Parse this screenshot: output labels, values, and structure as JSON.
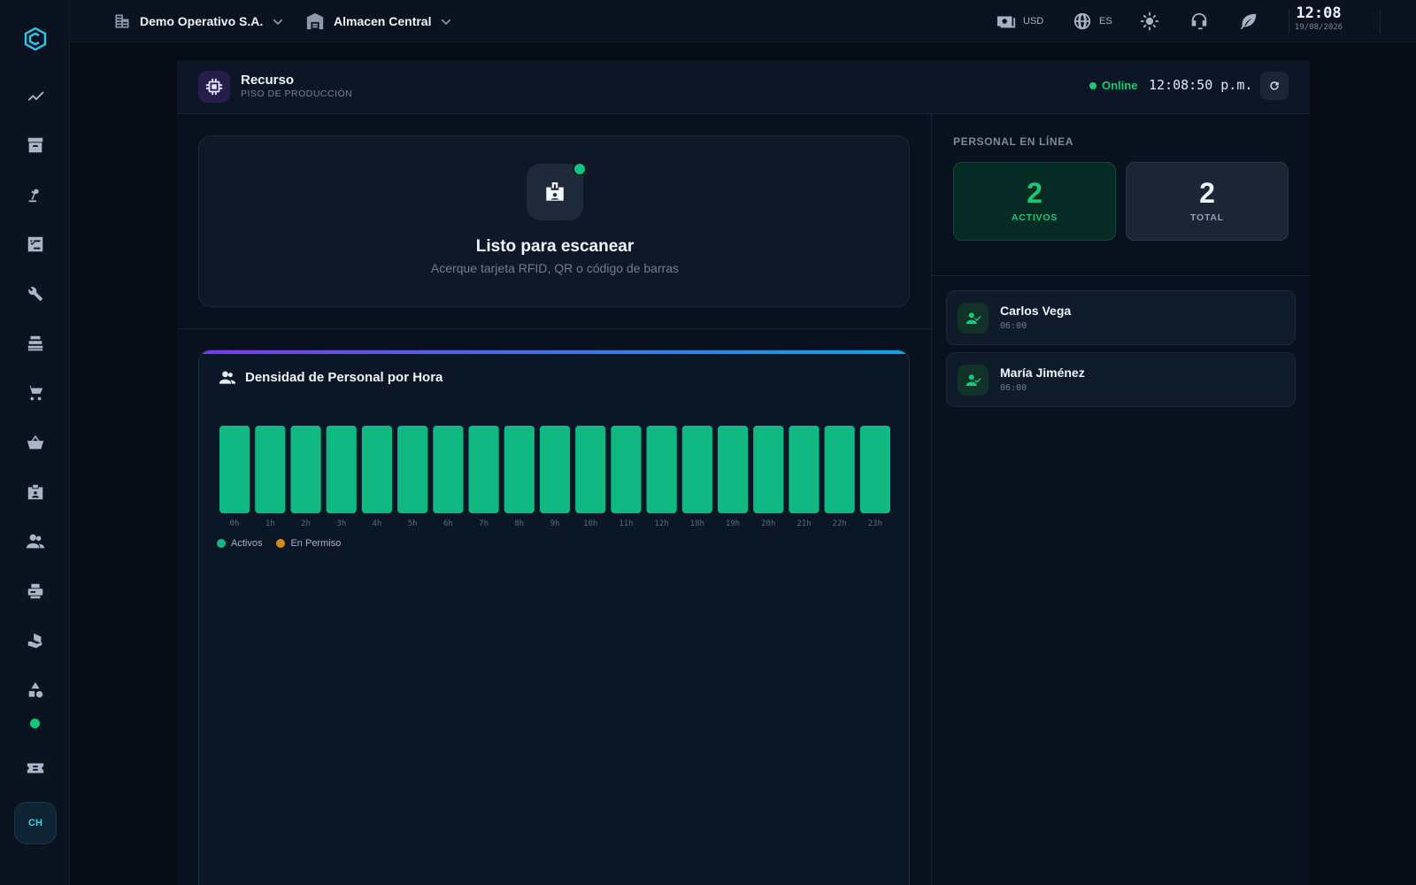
{
  "sidebar": {
    "logo": "brand-logo",
    "items": [
      {
        "icon": "trend-icon"
      },
      {
        "icon": "archive-icon"
      },
      {
        "icon": "robot-arm-icon"
      },
      {
        "icon": "checklist-icon"
      },
      {
        "icon": "wrench-icon"
      },
      {
        "icon": "server-icon"
      },
      {
        "icon": "cart-icon"
      },
      {
        "icon": "basket-icon"
      },
      {
        "icon": "badge-icon"
      },
      {
        "icon": "people-icon"
      },
      {
        "icon": "printer-icon"
      },
      {
        "icon": "package-hand-icon"
      },
      {
        "icon": "shapes-icon"
      },
      {
        "icon": "ticket-icon"
      }
    ],
    "avatar": "CH"
  },
  "topbar": {
    "company": "Demo Operativo S.A.",
    "warehouse": "Almacen Central",
    "currency": "USD",
    "language": "ES",
    "time": "12:08",
    "date": "19/08/2026"
  },
  "panel": {
    "title": "Recurso",
    "subtitle": "PISO DE PRODUCCIÓN",
    "status": "Online",
    "clock": "12:08:50 p.m."
  },
  "scan": {
    "title": "Listo para escanear",
    "subtitle": "Acerque tarjeta RFID, QR o código de barras"
  },
  "chart": {
    "title": "Densidad de Personal por Hora",
    "legend": [
      {
        "label": "Activos",
        "color": "#10b981"
      },
      {
        "label": "En Permiso",
        "color": "#d48a1a"
      }
    ]
  },
  "chart_data": {
    "type": "bar",
    "title": "Densidad de Personal por Hora",
    "categories": [
      "0h",
      "1h",
      "2h",
      "3h",
      "4h",
      "5h",
      "6h",
      "7h",
      "8h",
      "9h",
      "10h",
      "11h",
      "12h",
      "18h",
      "19h",
      "20h",
      "21h",
      "22h",
      "23h"
    ],
    "series": [
      {
        "name": "Activos",
        "values": [
          2,
          2,
          2,
          2,
          2,
          2,
          2,
          2,
          2,
          2,
          2,
          2,
          2,
          2,
          2,
          2,
          2,
          2,
          2
        ]
      },
      {
        "name": "En Permiso",
        "values": [
          0,
          0,
          0,
          0,
          0,
          0,
          0,
          0,
          0,
          0,
          0,
          0,
          0,
          0,
          0,
          0,
          0,
          0,
          0
        ]
      }
    ],
    "ylim": [
      0,
      2
    ],
    "legend_position": "bottom-left",
    "grid": false
  },
  "online": {
    "label": "PERSONAL EN LÍNEA",
    "active_value": "2",
    "active_label": "ACTIVOS",
    "total_value": "2",
    "total_label": "TOTAL"
  },
  "people": [
    {
      "name": "Carlos Vega",
      "time": "06:00"
    },
    {
      "name": "María Jiménez",
      "time": "06:00"
    }
  ],
  "colors": {
    "accent": "#10c777",
    "brand": "#3fd0e8",
    "bar": "#10b981"
  }
}
